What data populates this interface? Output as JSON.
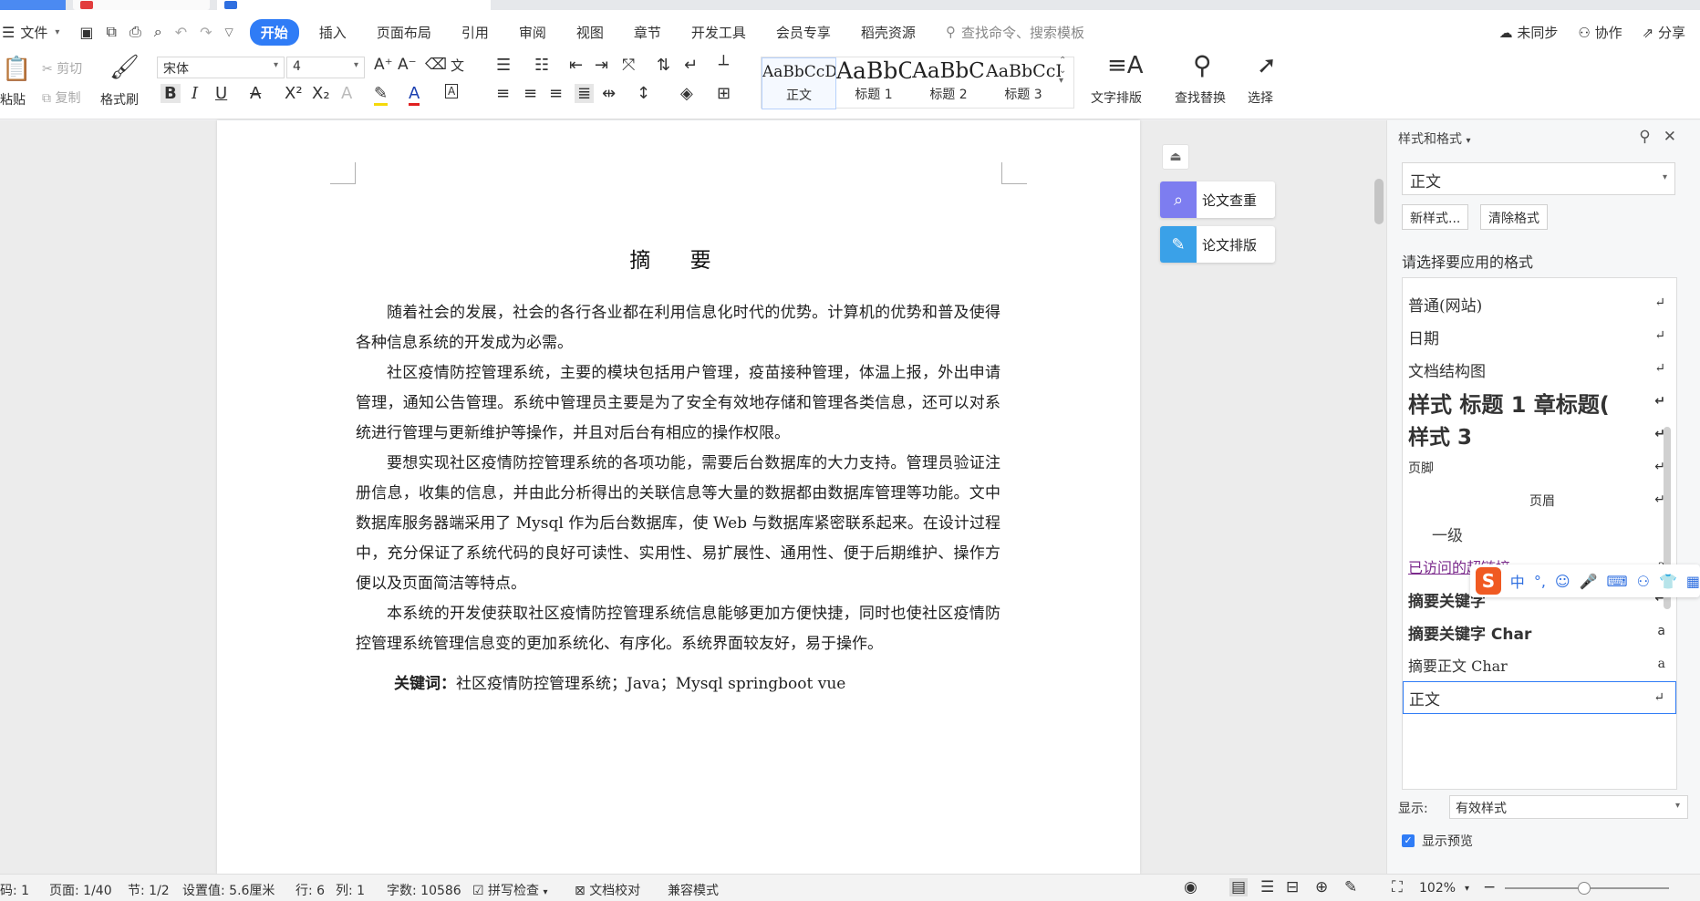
{
  "menu": {
    "file": "文件",
    "tabs": [
      "开始",
      "插入",
      "页面布局",
      "引用",
      "审阅",
      "视图",
      "章节",
      "开发工具",
      "会员专享",
      "稻壳资源"
    ],
    "search_placeholder": "查找命令、搜索模板",
    "sync": "未同步",
    "collab": "协作",
    "share": "分享"
  },
  "ribbon": {
    "paste": "粘贴",
    "cut": "剪切",
    "copy": "复制",
    "format_painter": "格式刷",
    "font_name": "宋体",
    "font_size": "4",
    "styles": [
      {
        "preview": "AaBbCcDd",
        "name": "正文"
      },
      {
        "preview": "AaBbC",
        "name": "标题 1"
      },
      {
        "preview": "AaBbC",
        "name": "标题 2"
      },
      {
        "preview": "AaBbCcI",
        "name": "标题 3"
      }
    ],
    "text_layout": "文字排版",
    "find_replace": "查找替换",
    "select": "选择"
  },
  "document": {
    "title": "摘 要",
    "paragraphs": [
      "随着社会的发展，社会的各行各业都在利用信息化时代的优势。计算机的优势和普及使得各种信息系统的开发成为必需。",
      "社区疫情防控管理系统，主要的模块包括用户管理，疫苗接种管理，体温上报，外出申请管理，通知公告管理。系统中管理员主要是为了安全有效地存储和管理各类信息，还可以对系统进行管理与更新维护等操作，并且对后台有相应的操作权限。",
      "要想实现社区疫情防控管理系统的各项功能，需要后台数据库的大力支持。管理员验证注册信息，收集的信息，并由此分析得出的关联信息等大量的数据都由数据库管理等功能。文中数据库服务器端采用了 Mysql 作为后台数据库，使 Web 与数据库紧密联系起来。在设计过程中，充分保证了系统代码的良好可读性、实用性、易扩展性、通用性、便于后期维护、操作方便以及页面简洁等特点。",
      "本系统的开发使获取社区疫情防控管理系统信息能够更加方便快捷，同时也使社区疫情防控管理系统管理信息变的更加系统化、有序化。系统界面较友好，易于操作。"
    ],
    "keywords_label": "关键词：",
    "keywords": "社区疫情防控管理系统；Java；Mysql springboot vue"
  },
  "side_tools": {
    "paper_check": "论文查重",
    "paper_format": "论文排版"
  },
  "pane": {
    "title": "样式和格式",
    "current_style": "正文",
    "new_style": "新样式...",
    "clear_format": "清除格式",
    "apply_label": "请选择要应用的格式",
    "styles": [
      {
        "name": "普通(网站)",
        "mark": "↵"
      },
      {
        "name": "日期",
        "mark": "↵"
      },
      {
        "name": "文档结构图",
        "mark": "↵"
      },
      {
        "name": "样式 标题 1 章标题(",
        "mark": "↵"
      },
      {
        "name": "样式 3",
        "mark": "↵"
      },
      {
        "name": "页脚",
        "mark": "↵"
      },
      {
        "name": "页眉",
        "mark": "↵"
      },
      {
        "name": "一级",
        "mark": ""
      },
      {
        "name": "已访问的超链接",
        "mark": "a"
      },
      {
        "name": "摘要关键字",
        "mark": "↵"
      },
      {
        "name": "摘要关键字 Char",
        "mark": "a"
      },
      {
        "name": "摘要正文 Char",
        "mark": "a"
      },
      {
        "name": "正文",
        "mark": "↵"
      }
    ],
    "show_label": "显示:",
    "show_value": "有效样式",
    "show_preview": "显示预览"
  },
  "ime": {
    "logo": "S",
    "mode": "中"
  },
  "status": {
    "page_num": "码: 1",
    "page": "页面: 1/40",
    "section": "节: 1/2",
    "setting": "设置值: 5.6厘米",
    "row": "行: 6",
    "col": "列: 1",
    "words": "字数: 10586",
    "spell": "拼写检查",
    "proof": "文档校对",
    "compat": "兼容模式",
    "zoom": "102%"
  },
  "colors": {
    "accent": "#2f7cf6",
    "visited_link": "#7b2a8c"
  }
}
